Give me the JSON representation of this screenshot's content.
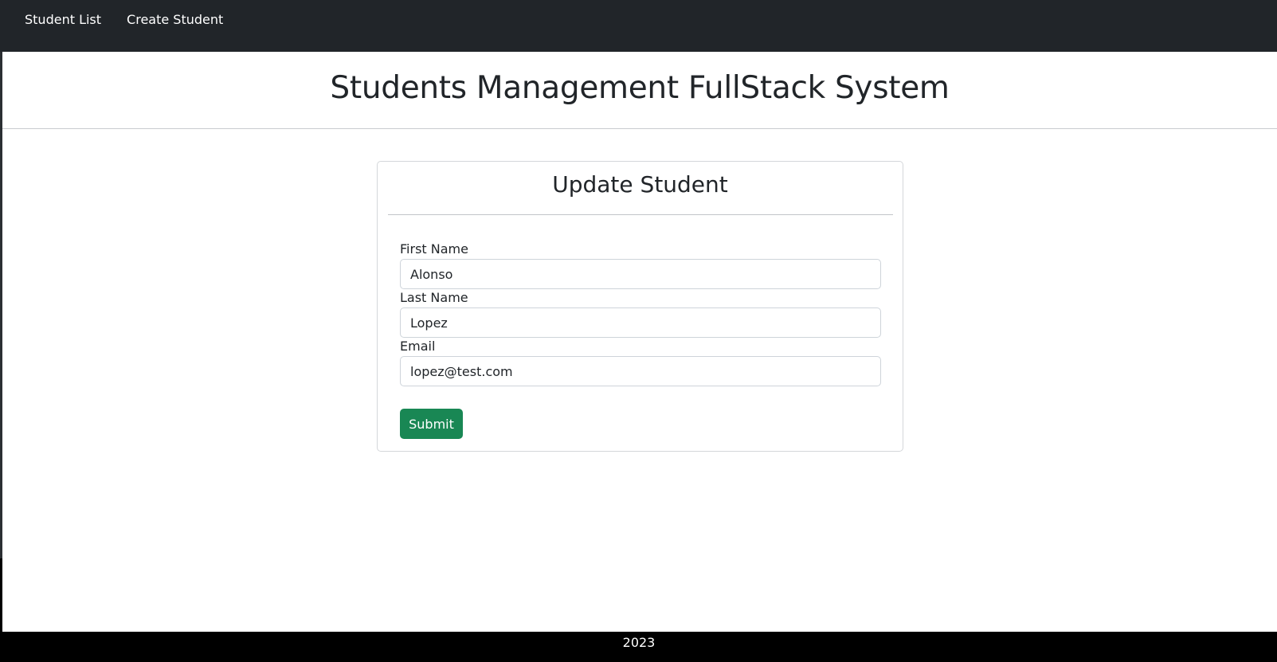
{
  "navbar": {
    "links": [
      {
        "label": "Student List"
      },
      {
        "label": "Create Student"
      }
    ]
  },
  "header": {
    "title": "Students Management FullStack System"
  },
  "form": {
    "title": "Update Student",
    "fields": [
      {
        "label": "First Name",
        "value": "Alonso"
      },
      {
        "label": "Last Name",
        "value": "Lopez"
      },
      {
        "label": "Email",
        "value": "lopez@test.com"
      }
    ],
    "submit_label": "Submit"
  },
  "footer": {
    "text": "2023"
  },
  "colors": {
    "navbar_bg": "#212529",
    "submit_bg": "#198754",
    "footer_bg": "#000000"
  }
}
